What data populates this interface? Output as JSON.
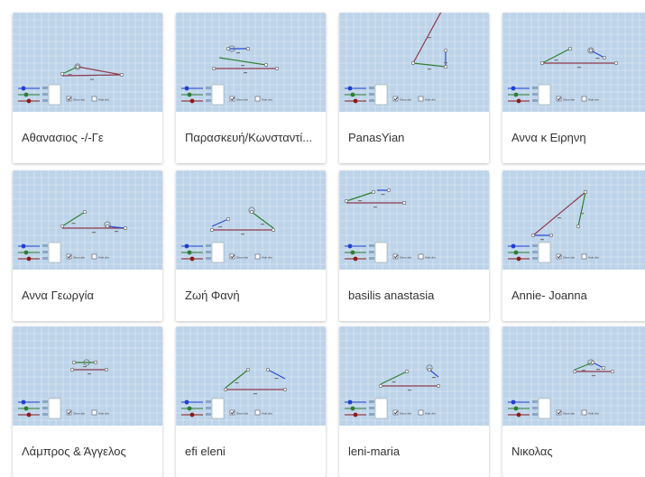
{
  "page": {
    "background": "#ffffff"
  },
  "thumbnail_style": {
    "background": "#bcd3e9",
    "grid_color": "#ffffff",
    "slider_colors": [
      "#1f3fd0",
      "#2e7d32",
      "#8b1a1a"
    ],
    "segment_colors": [
      "#2f7f2f",
      "#8e3b4c",
      "#2a4bd7"
    ],
    "checkbox_labels": [
      "Show dist",
      "Hide dist"
    ]
  },
  "cards": [
    {
      "title": "Αθανασιος -/-Γε",
      "variant": 0
    },
    {
      "title": "Παρασκευή/Κωνσταντί...",
      "variant": 1
    },
    {
      "title": "PanasYian",
      "variant": 2
    },
    {
      "title": "Αννα κ Ειρηνη",
      "variant": 3
    },
    {
      "title": "Αννα Γεωργία",
      "variant": 4
    },
    {
      "title": "Ζωή Φανή",
      "variant": 5
    },
    {
      "title": "basilis anastasia",
      "variant": 6
    },
    {
      "title": "Annie- Joanna",
      "variant": 7
    },
    {
      "title": "Λάμπρος & Άγγελος",
      "variant": 8
    },
    {
      "title": "efi eleni",
      "variant": 9
    },
    {
      "title": "leni-maria",
      "variant": 10
    },
    {
      "title": "Νικολας",
      "variant": 11
    }
  ]
}
